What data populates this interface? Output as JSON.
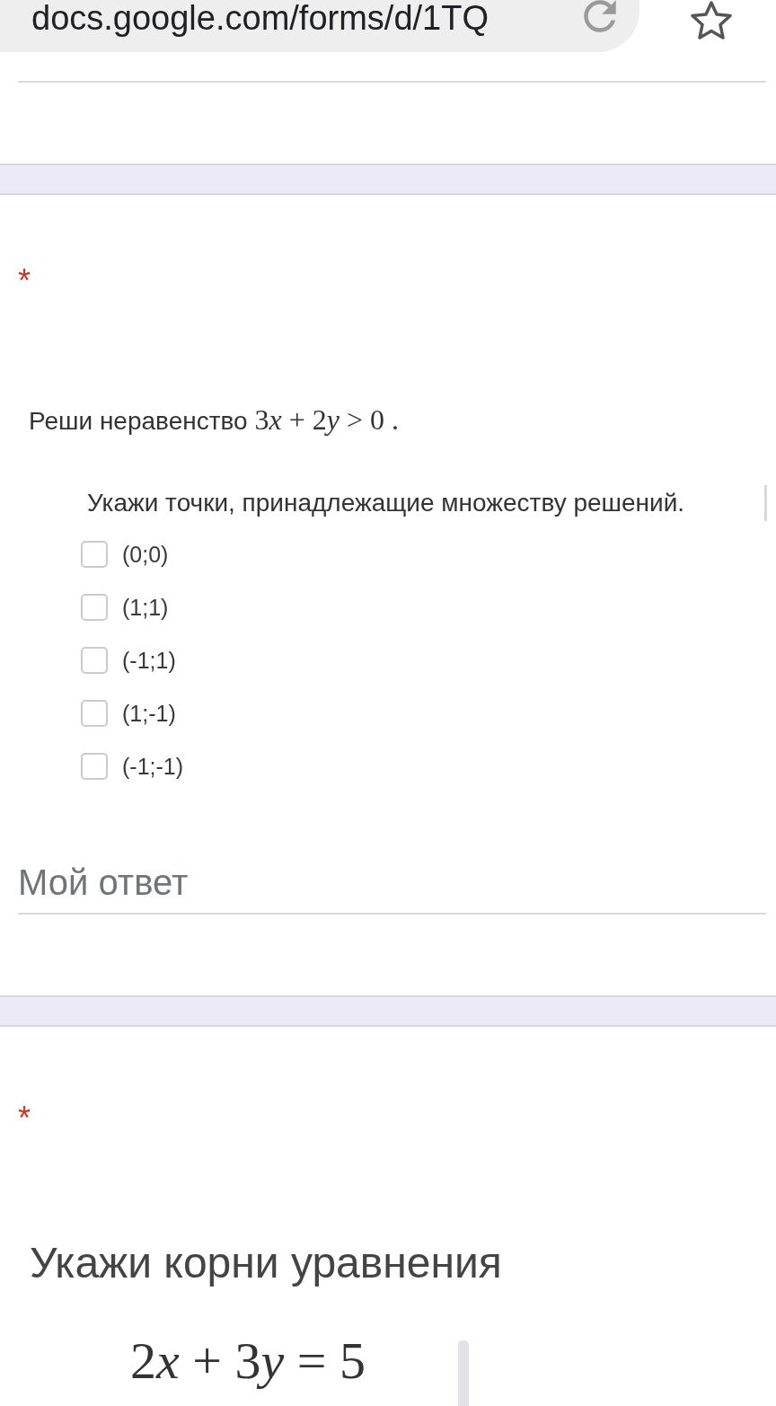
{
  "browser": {
    "url": "docs.google.com/forms/d/1TQ"
  },
  "form_items": [
    {
      "kind": "answer_field"
    },
    {
      "kind": "band"
    },
    {
      "kind": "question",
      "required_mark": "*",
      "image": {
        "kind": "checklist",
        "title": "Реши неравенство",
        "formula": "3x + 2y > 0 .",
        "instruction": "Укажи точки, принадлежащие множеству решений.",
        "options": [
          {
            "label": "(0;0)",
            "checked": false
          },
          {
            "label": "(1;1)",
            "checked": false
          },
          {
            "label": "(-1;1)",
            "checked": false
          },
          {
            "label": "(1;-1)",
            "checked": false
          },
          {
            "label": "(-1;-1)",
            "checked": false
          }
        ]
      },
      "answer": {
        "placeholder": "Мой ответ"
      }
    },
    {
      "kind": "band"
    },
    {
      "kind": "question",
      "required_mark": "*",
      "image": {
        "kind": "equation",
        "title": "Укажи корни уравнения",
        "formula": "2x + 3y = 5"
      }
    }
  ]
}
